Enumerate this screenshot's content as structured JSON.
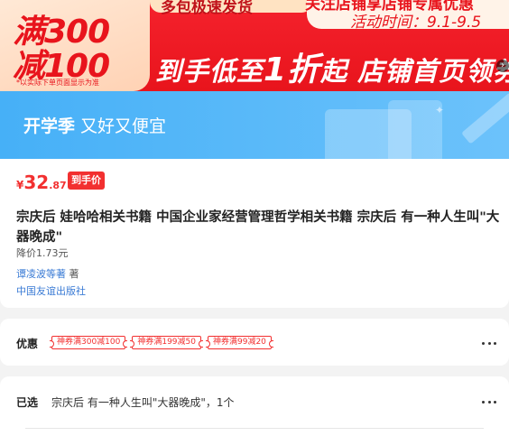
{
  "promo_banner": {
    "corner_line1": "满300",
    "corner_line2": "减100",
    "corner_note": "*以实际下单页面显示为准",
    "top_strip": "多包极速发货",
    "right_top_1": "关注店铺享店铺专属优惠",
    "right_top_2": "活动时间：9.1-9.5",
    "headline_a": "到手低至",
    "headline_big": "1折",
    "headline_b": "起 店铺首页领券",
    "nav_arrow": "›"
  },
  "season_banner": {
    "title_strong": "开学季",
    "title_rest": " 又好又便宜"
  },
  "product": {
    "price_symbol": "¥",
    "price_int": "32",
    "price_dec": ".87",
    "price_tag": "到手价",
    "title": "宗庆后 娃哈哈相关书籍 中国企业家经营管理哲学相关书籍 宗庆后 有一种人生叫\"大器晚成\"",
    "reduction": "降价1.73元",
    "author_name": "谭凌波等著",
    "author_role": " 著",
    "publisher": "中国友谊出版社"
  },
  "offers": {
    "label": "优惠",
    "coupons": [
      "神券满300减100",
      "神券满199减50",
      "神券满99减20"
    ]
  },
  "selected": {
    "label": "已选",
    "value": "宗庆后 有一种人生叫\"大器晚成\"，1个"
  }
}
